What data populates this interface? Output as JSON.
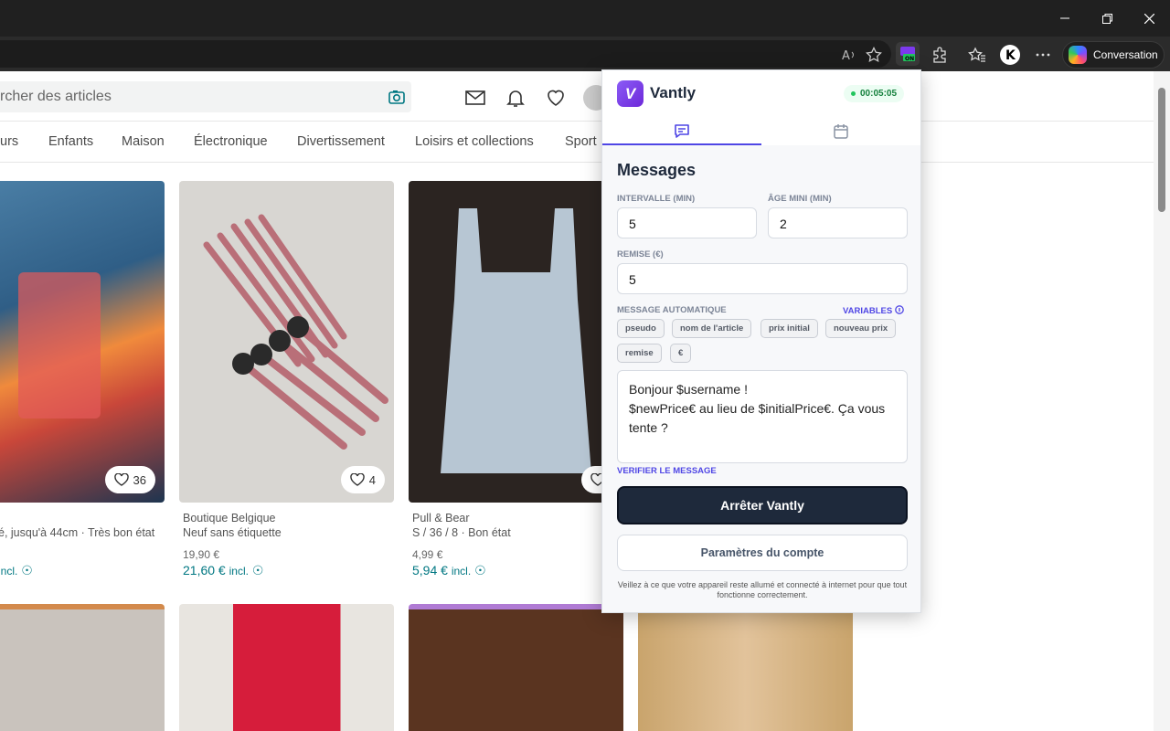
{
  "browser": {
    "conversation_label": "Conversation"
  },
  "page": {
    "search_placeholder": "rcher des articles",
    "categories": [
      "urs",
      "Enfants",
      "Maison",
      "Électronique",
      "Divertissement",
      "Loisirs et collections",
      "Sport"
    ],
    "items": [
      {
        "likes": "36",
        "brand": "",
        "subtitle": "é, jusqu'à 44cm · Très bon état",
        "price": "",
        "price_incl": "",
        "incl_label": "incl."
      },
      {
        "likes": "4",
        "brand": "Boutique Belgique",
        "subtitle": "Neuf sans étiquette",
        "price": "19,90 €",
        "price_incl": "21,60 €",
        "incl_label": "incl."
      },
      {
        "likes": "",
        "brand": "Pull & Bear",
        "subtitle": "S / 36 / 8 · Bon état",
        "price": "4,99 €",
        "price_incl": "5,94 €",
        "incl_label": "incl."
      }
    ]
  },
  "popup": {
    "brand": "Vantly",
    "logo_letter": "V",
    "timer": "00:05:05",
    "title": "Messages",
    "interval_label": "INTERVALLE (MIN)",
    "interval_value": "5",
    "min_age_label": "ÂGE MINI (MIN)",
    "min_age_value": "2",
    "discount_label": "REMISE (€)",
    "discount_value": "5",
    "auto_message_label": "MESSAGE AUTOMATIQUE",
    "variables_label": "VARIABLES",
    "chips": [
      "pseudo",
      "nom de l'article",
      "prix initial",
      "nouveau prix",
      "remise",
      "€"
    ],
    "message": "Bonjour $username !\n$newPrice€ au lieu de $initialPrice€. Ça vous tente ?",
    "verify_label": "VERIFIER LE MESSAGE",
    "stop_label": "Arrêter Vantly",
    "account_label": "Paramètres du compte",
    "note": "Veillez à ce que votre appareil reste allumé et connecté à internet pour que tout fonctionne correctement."
  }
}
